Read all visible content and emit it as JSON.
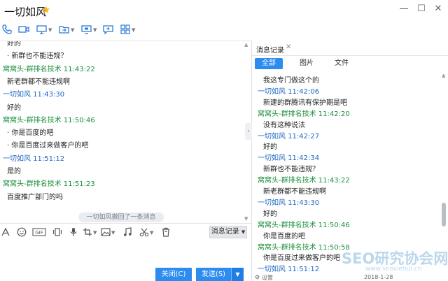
{
  "window": {
    "title": "一切如风",
    "minimize": "—",
    "maximize": "☐",
    "close": "✕"
  },
  "toolbar": {
    "icons": [
      "phone-icon",
      "video-icon",
      "screen-share-icon",
      "file-transfer-icon",
      "remote-desktop-icon",
      "add-chat-icon",
      "apps-icon"
    ]
  },
  "chat": {
    "lines": [
      {
        "type": "text",
        "text": "好的"
      },
      {
        "type": "text",
        "text": "· 新群也不能违规？"
      },
      {
        "type": "sender-other",
        "text": "窝窝头-群排名技术  11:43:22"
      },
      {
        "type": "text",
        "text": "新老群都不能违规啊"
      },
      {
        "type": "sender-self",
        "text": "一切如风  11:43:30"
      },
      {
        "type": "text",
        "text": "好的"
      },
      {
        "type": "sender-other",
        "text": "窝窝头-群排名技术  11:50:46"
      },
      {
        "type": "text",
        "text": "· 你是百度的吧"
      },
      {
        "type": "text",
        "text": "· 你是百度过来做客户的吧"
      },
      {
        "type": "sender-self",
        "text": "一切如风  11:51:12"
      },
      {
        "type": "text",
        "text": "是的"
      },
      {
        "type": "sender-other",
        "text": "窝窝头-群排名技术  11:51:23"
      },
      {
        "type": "text",
        "text": "百度推广部门的吗"
      }
    ],
    "recall_notice": "一切如风撤回了一条消息"
  },
  "input_bar": {
    "icons": [
      "font-icon",
      "emoji-icon",
      "gif-icon",
      "shake-icon",
      "voice-icon",
      "screenshot-icon",
      "image-icon",
      "music-icon",
      "scissors-icon",
      "trash-icon"
    ],
    "history_button": "消息记录"
  },
  "send": {
    "close_label": "关闭(C)",
    "send_label": "发送(S)"
  },
  "history": {
    "tab_label": "消息记录",
    "filters": [
      "全部",
      "图片",
      "文件"
    ],
    "active_filter": "全部",
    "lines": [
      {
        "type": "text",
        "text": "我这专门做这个的"
      },
      {
        "type": "sender-self",
        "text": "一切如风  11:42:06"
      },
      {
        "type": "text",
        "text": "新建的群腾讯有保护期是吧"
      },
      {
        "type": "sender-other",
        "text": "窝窝头-群排名技术  11:42:20"
      },
      {
        "type": "text",
        "text": "没有这种说法"
      },
      {
        "type": "sender-self",
        "text": "一切如风  11:42:27"
      },
      {
        "type": "text",
        "text": "好的"
      },
      {
        "type": "sender-self",
        "text": "一切如风  11:42:34"
      },
      {
        "type": "text",
        "text": "新群也不能违规？"
      },
      {
        "type": "sender-other",
        "text": "窝窝头-群排名技术  11:43:22"
      },
      {
        "type": "text",
        "text": "新老群都不能违规啊"
      },
      {
        "type": "sender-self",
        "text": "一切如风  11:43:30"
      },
      {
        "type": "text",
        "text": "好的"
      },
      {
        "type": "sender-other",
        "text": "窝窝头-群排名技术  11:50:46"
      },
      {
        "type": "text",
        "text": "你是百度的吧"
      },
      {
        "type": "sender-other",
        "text": "窝窝头-群排名技术  11:50:58"
      },
      {
        "type": "text",
        "text": "你是百度过来做客户的吧"
      },
      {
        "type": "sender-self",
        "text": "一切如风  11:51:12"
      }
    ],
    "bottom_settings": "设置",
    "bottom_date": "2018-1-28"
  },
  "watermark": {
    "main": "SEO研究协会网",
    "sub": "www.seoxiehui.cn"
  },
  "colors": {
    "accent": "#2d8cf0",
    "sender_other": "#1a8f3c",
    "sender_self": "#1d66c4"
  }
}
